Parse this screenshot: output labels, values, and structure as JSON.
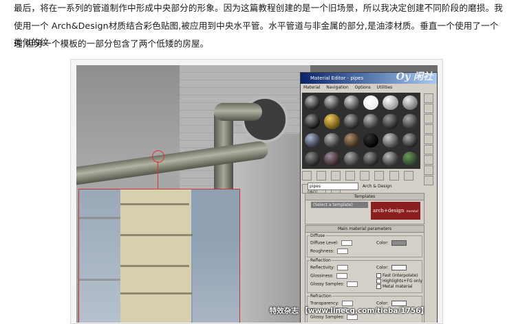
{
  "paragraph": {
    "line1": "最后，将在一系列的管道制作中形成中央部分的形象。因为这篇教程创建的是一个旧场景，所以我决定创建不同阶段的磨损。我",
    "line2": "使用一个 Arch&Design材质结合彩色贴图,被应用到中央水平管。水平管道与非金属的部分,是油漆材质。垂直一个使用了一个类似的纹",
    "line3": "理,但另一个模板的一部分包含了两个低矮的房屋。"
  },
  "material_editor": {
    "title": "Material Editor - pipes",
    "logo_text": "Oy 闲社",
    "menu": [
      "Material",
      "Navigation",
      "Options",
      "Utilities"
    ],
    "material_name": "pipes",
    "material_type": "Arch & Design (mi)",
    "templates": {
      "header": "Templates",
      "select_placeholder": "(Select a template)",
      "brand": "arch+design",
      "brand_sub": "mental ray"
    },
    "main_header": "Main material parameters",
    "diffuse": {
      "section": "Diffuse",
      "level_label": "Diffuse Level:",
      "roughness_label": "Roughness:",
      "color_label": "Color:"
    },
    "reflection": {
      "section": "Reflection",
      "reflectivity_label": "Reflectivity:",
      "glossiness_label": "Glossiness:",
      "glossy_samples_label": "Glossy Samples:",
      "color_label": "Color:",
      "options": [
        "Fast (interpolate)",
        "Highlights+FG only",
        "Metal material"
      ]
    },
    "refraction": {
      "section": "Refraction",
      "transparency_label": "Transparency:",
      "glossiness_label": "Glossiness:",
      "glossy_samples_label": "Glossy Samples:",
      "color_label": "Color:"
    }
  },
  "watermark": "特效杂志  【www.linecg.com/tieba/1756】",
  "colors": {
    "title_bar": "#0a246a",
    "brand_red": "#8b1f1f",
    "accent_red": "#dd3333"
  }
}
